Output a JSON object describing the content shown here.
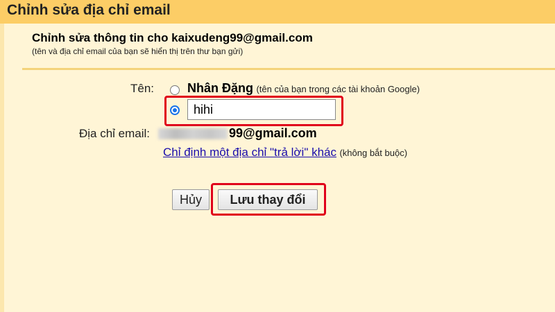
{
  "dialog": {
    "title": "Chỉnh sửa địa chỉ email"
  },
  "header": {
    "title": "Chỉnh sửa thông tin cho kaixudeng99@gmail.com",
    "subtitle": "(tên và địa chỉ email của bạn sẽ hiển thị trên thư bạn gửi)"
  },
  "form": {
    "name_label": "Tên:",
    "name_option_google": {
      "name": "Nhân Đặng",
      "hint": "(tên của bạn trong các tài khoản Google)",
      "selected": false
    },
    "name_option_custom": {
      "value": "hihi",
      "selected": true
    },
    "email_label": "Địa chỉ email:",
    "email_value_visible": "99@gmail.com",
    "reply_to_link": "Chỉ định một địa chỉ \"trả lời\" khác",
    "reply_to_optional": "(không bắt buộc)"
  },
  "buttons": {
    "cancel_label": "Hủy",
    "save_label": "Lưu thay đổi"
  },
  "colors": {
    "title_bar": "#fccd66",
    "background": "#fff5d6",
    "highlight": "#e0001b",
    "link": "#1a0dab",
    "radio_selected": "#1a73e8"
  }
}
